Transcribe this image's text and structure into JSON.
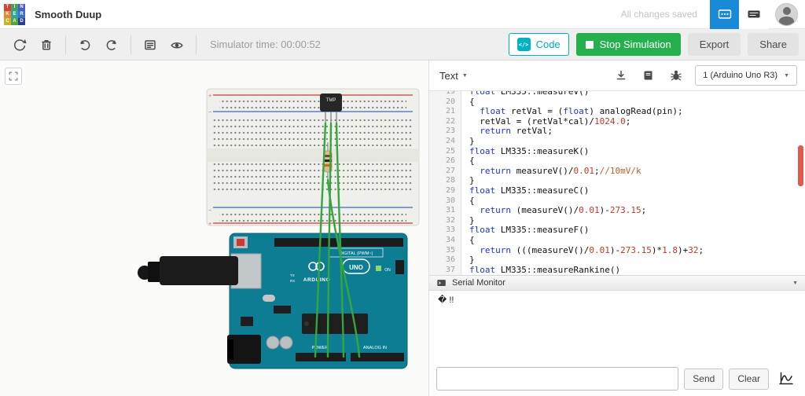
{
  "topbar": {
    "title": "Smooth Duup",
    "autosave": "All changes saved",
    "logo_letters": [
      "T",
      "I",
      "N",
      "K",
      "E",
      "R",
      "C",
      "A",
      "D"
    ],
    "logo_colors": [
      "#d9413d",
      "#3fa45f",
      "#4f5bd5",
      "#e8872b",
      "#2aa8a0",
      "#3b6fd4",
      "#c8b42a",
      "#57a33e",
      "#2b3f8f"
    ]
  },
  "toolbar": {
    "sim_time": "Simulator time: 00:00:52",
    "code_label": "Code",
    "stop_label": "Stop Simulation",
    "export_label": "Export",
    "share_label": "Share"
  },
  "code_panel": {
    "mode": "Text",
    "board_select": "1 (Arduino Uno R3)",
    "first_line_number": 19,
    "lines": [
      "float LM335::measureV()",
      "{",
      "  float retVal = (float) analogRead(pin);",
      "  retVal = (retVal*cal)/1024.0;",
      "  return retVal;",
      "}",
      "float LM335::measureK()",
      "{",
      "  return measureV()/0.01;//10mV/k",
      "}",
      "float LM335::measureC()",
      "{",
      "  return (measureV()/0.01)-273.15;",
      "}",
      "float LM335::measureF()",
      "{",
      "  return (((measureV()/0.01)-273.15)*1.8)+32;",
      "}",
      "float LM335::measureRankine()"
    ]
  },
  "serial": {
    "title": "Serial Monitor",
    "output": "� !!",
    "input_value": "",
    "send_label": "Send",
    "clear_label": "Clear"
  },
  "circuit": {
    "labels": {
      "tmp": "TMP",
      "digital": "DIGITAL (PWM~)",
      "power": "POWER",
      "analog": "ANALOG IN",
      "uno": "UNO",
      "arduino": "ARDUINO",
      "on": "ON",
      "tx": "TX",
      "rx": "RX",
      "plus": "+",
      "minus": "−"
    }
  },
  "icons": {
    "caret": "▼",
    "code-icon": "</>",
    "rotate-icon": "circular-arrow",
    "delete-icon": "trash-can",
    "undo-icon": "arrow-curved-left",
    "redo-icon": "arrow-curved-right",
    "annotation-icon": "note-lines",
    "visibility-icon": "eye",
    "stop-icon": "square",
    "download-icon": "arrow-down-tray",
    "libraries-icon": "book",
    "debug-icon": "bug",
    "graph-icon": "waveform",
    "circuits-icon": "circuit-board",
    "shortcuts-icon": "keyboard",
    "fit-view-icon": "corner-brackets",
    "serial-icon": "terminal"
  },
  "colors": {
    "teal": "#00b1c1",
    "green": "#24b04c",
    "blue": "#1989d8",
    "scroll_thumb": "#e05a4e",
    "wire_green": "#35a63c",
    "board_teal": "#0d7d94"
  }
}
